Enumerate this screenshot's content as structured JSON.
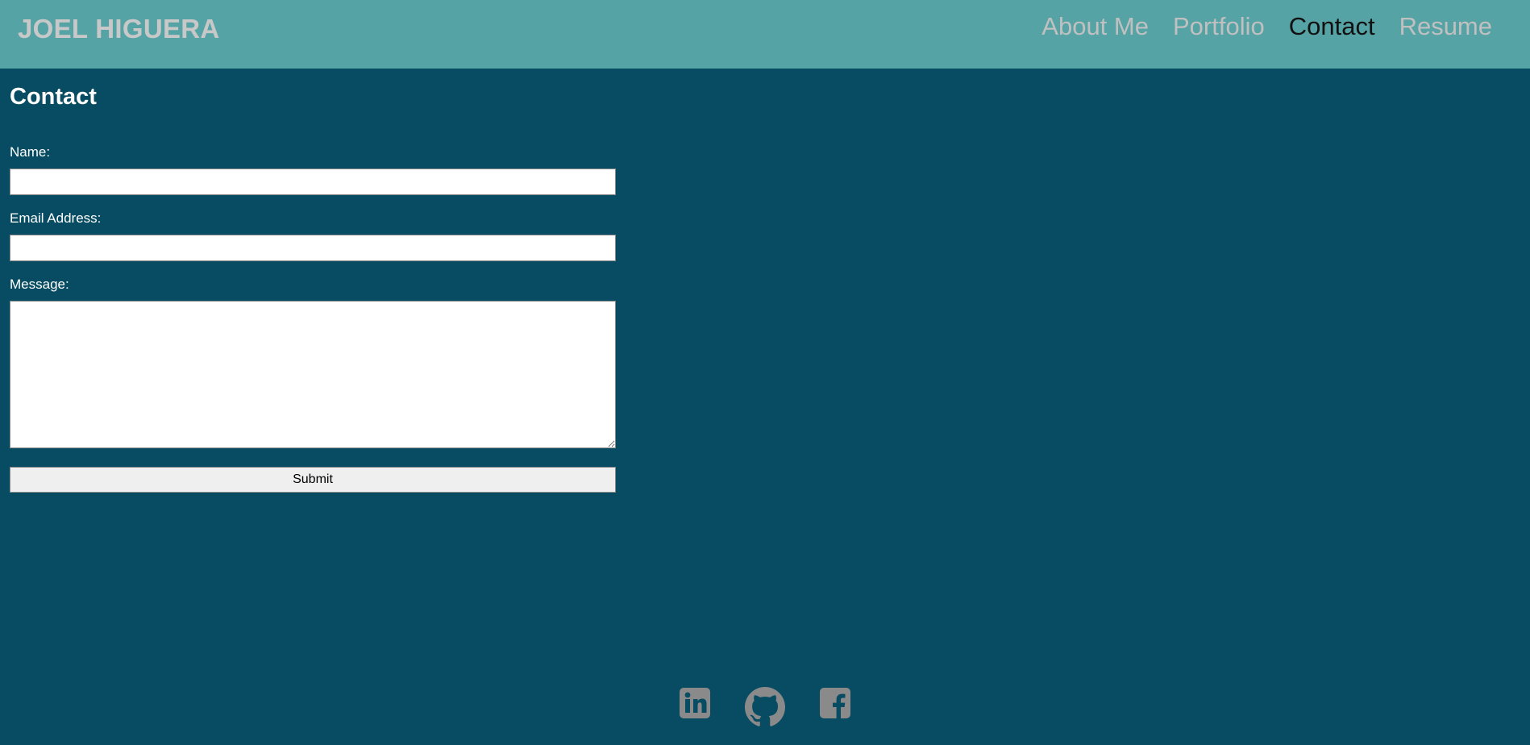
{
  "header": {
    "brand": "JOEL HIGUERA",
    "nav": [
      {
        "label": "About Me",
        "active": false
      },
      {
        "label": "Portfolio",
        "active": false
      },
      {
        "label": "Contact",
        "active": true
      },
      {
        "label": "Resume",
        "active": false
      }
    ]
  },
  "main": {
    "title": "Contact",
    "form": {
      "name_label": "Name:",
      "name_value": "",
      "email_label": "Email Address:",
      "email_value": "",
      "message_label": "Message:",
      "message_value": "",
      "submit_label": "Submit"
    }
  },
  "footer": {
    "icons": [
      "linkedin-icon",
      "github-icon",
      "facebook-icon"
    ]
  },
  "colors": {
    "header_bg": "#56a3a5",
    "page_bg": "#074c62",
    "nav_text": "#c0c0c0",
    "nav_active": "#111111",
    "icon": "#8a8a8a"
  }
}
